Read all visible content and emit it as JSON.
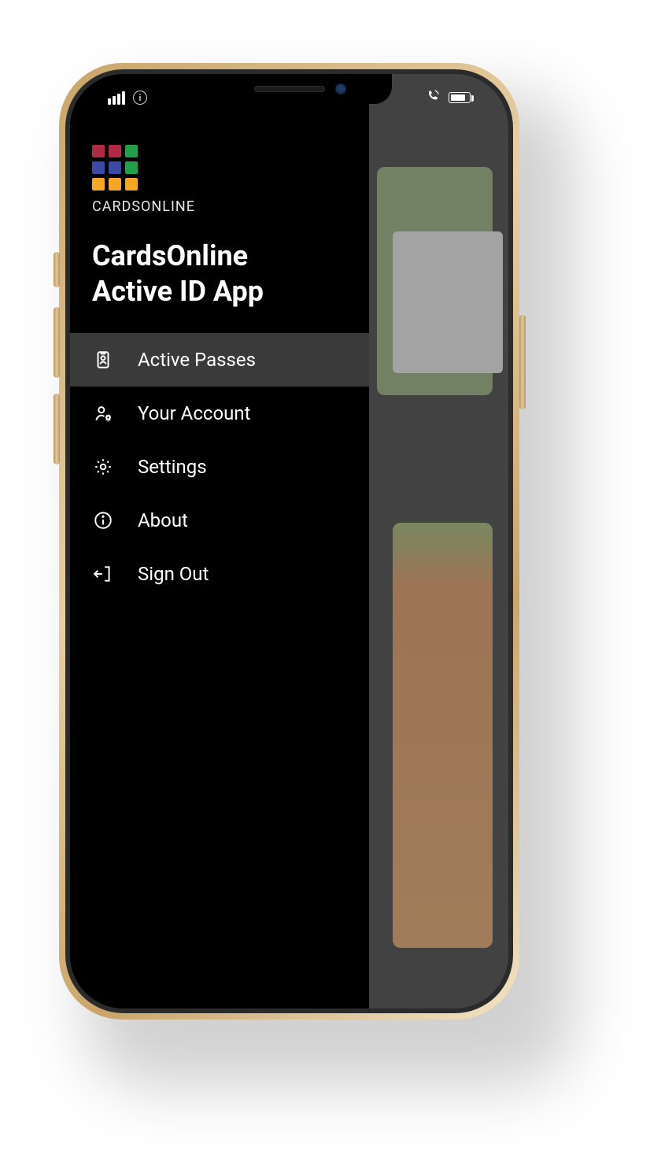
{
  "brand": {
    "logo_text": "CARDSONLINE"
  },
  "drawer": {
    "title_line1": "CardsOnline",
    "title_line2": "Active ID App",
    "menu": [
      {
        "label": "Active Passes",
        "icon": "id-badge-icon",
        "active": true
      },
      {
        "label": "Your Account",
        "icon": "user-gear-icon",
        "active": false
      },
      {
        "label": "Settings",
        "icon": "gear-icon",
        "active": false
      },
      {
        "label": "About",
        "icon": "info-icon",
        "active": false
      },
      {
        "label": "Sign Out",
        "icon": "sign-out-icon",
        "active": false
      }
    ]
  },
  "status": {
    "info_glyph": "i"
  }
}
